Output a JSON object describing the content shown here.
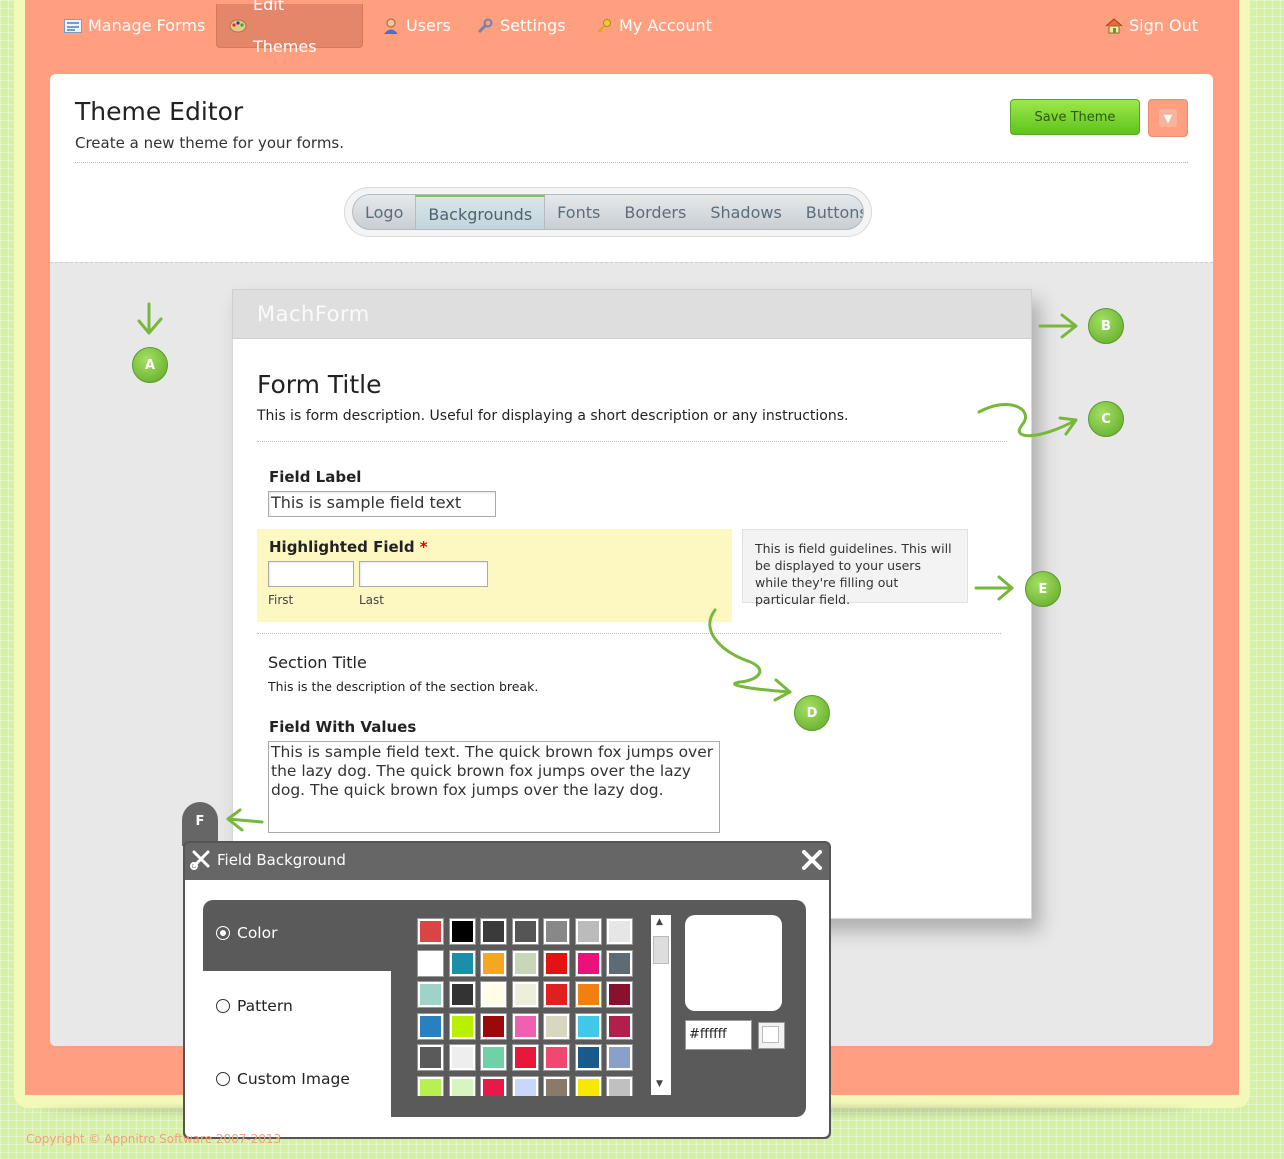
{
  "nav": {
    "items": [
      {
        "label": "Manage Forms",
        "icon": "forms-icon"
      },
      {
        "label": "Edit Themes",
        "icon": "palette-icon"
      },
      {
        "label": "Users",
        "icon": "user-icon"
      },
      {
        "label": "Settings",
        "icon": "wrench-icon"
      },
      {
        "label": "My Account",
        "icon": "key-icon"
      }
    ],
    "active_index": 1,
    "sign_out": {
      "label": "Sign Out",
      "icon": "home-icon"
    }
  },
  "header": {
    "title": "Theme Editor",
    "subtitle": "Create a new theme for your forms.",
    "save_label": "Save Theme",
    "dropdown_icon": "chevron-down-icon"
  },
  "tabs": {
    "items": [
      "Logo",
      "Backgrounds",
      "Fonts",
      "Borders",
      "Shadows",
      "Buttons"
    ],
    "active_index": 1
  },
  "preview": {
    "logo": "MachForm",
    "form_title": "Form Title",
    "form_description": "This is form description. Useful for displaying a short description or any instructions.",
    "field_label": "Field Label",
    "field_value": "This is sample field text",
    "highlighted_label": "Highlighted Field",
    "required_mark": "*",
    "sublabel_first": "First",
    "sublabel_last": "Last",
    "guidelines": "This is field guidelines. This will be displayed to your users while they're filling out particular field.",
    "section_title": "Section Title",
    "section_description": "This is the description of the section break.",
    "values_label": "Field With Values",
    "textarea_value": "This is sample field text. The quick brown fox jumps over the lazy dog. The quick brown fox jumps over the lazy dog. The quick brown fox jumps over the lazy dog."
  },
  "markers": [
    "A",
    "B",
    "C",
    "D",
    "E",
    "F"
  ],
  "panel": {
    "title": "Field Background",
    "options": [
      "Color",
      "Pattern",
      "Custom Image"
    ],
    "selected_option": "Color",
    "hex_value": "#ffffff",
    "swatches": [
      [
        "#d94444",
        "#000000",
        "#3a3a3a",
        "#555555",
        "#888888",
        "#bbbbbb",
        "#e6e6e6"
      ],
      [
        "#ffffff",
        "#1c8ea8",
        "#f5a623",
        "#c8d6b9",
        "#e31313",
        "#e8127a",
        "#5c6b78"
      ],
      [
        "#9fd3c7",
        "#333333",
        "#fffde8",
        "#eeeedd",
        "#e02020",
        "#f08010",
        "#8a1030"
      ],
      [
        "#2a7fbf",
        "#b8f000",
        "#9a0a0a",
        "#f060b0",
        "#d8d8c0",
        "#40c8e8",
        "#b0204a"
      ],
      [
        "#5a5a5a",
        "#eeeeee",
        "#70d0a8",
        "#e8183a",
        "#f04870",
        "#1a5a8a",
        "#8aa0c8"
      ],
      [
        "#b8f050",
        "#d8f5c0",
        "#e81848",
        "#c8d8f8",
        "#8a7a6a",
        "#f8e800",
        "#c0c0c0"
      ]
    ]
  },
  "footer": {
    "copyright": "Copyright © Appnitro Software 2007-2013"
  }
}
